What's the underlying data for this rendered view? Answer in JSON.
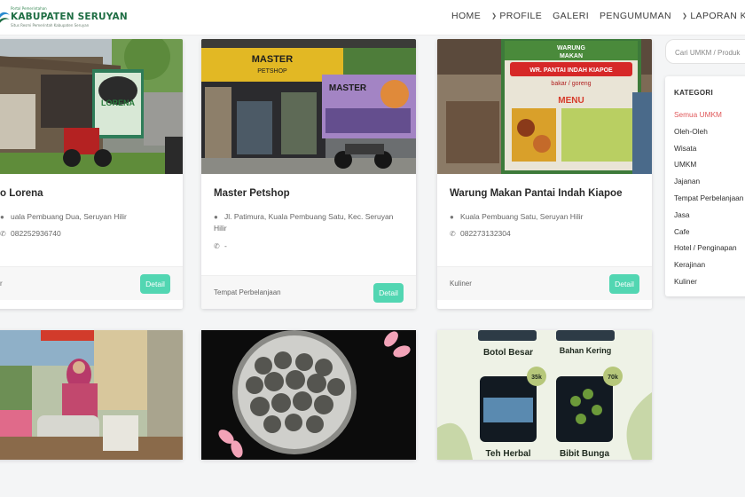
{
  "brand": {
    "small": "Portal Pemerintahan",
    "title": "KABUPATEN SERUYAN",
    "tagline": "Situs Resmi Pemerintah Kabupaten Seruyan"
  },
  "nav": {
    "home": "HOME",
    "profile": "PROFILE",
    "galeri": "GALERI",
    "pengumuman": "PENGUMUMAN",
    "laporan": "LAPORAN KEUA"
  },
  "colors": {
    "accent": "#52d6b2",
    "active_category": "#e0585a",
    "brand": "#1f6e44"
  },
  "cards": [
    {
      "title": "o Lorena",
      "address": "uala Pembuang Dua, Seruyan Hilir",
      "phone": "082252936740",
      "category": "r",
      "detail": "Detail",
      "sign": "LORENA"
    },
    {
      "title": "Master Petshop",
      "address": "Jl. Patimura, Kuala Pembuang Satu, Kec. Seruyan Hilir",
      "phone": "-",
      "category": "Tempat Perbelanjaan",
      "detail": "Detail",
      "sign": "MASTER",
      "sign2": "MASTER",
      "sign3": "PETSHOP"
    },
    {
      "title": "Warung Makan Pantai Indah Kiapoe",
      "address": "Kuala Pembuang Satu, Seruyan Hilir",
      "phone": "082273132304",
      "category": "Kuliner",
      "detail": "Detail",
      "sign_top": "WARUNG",
      "sign_mid": "MAKAN",
      "sign_name": "WR. PANTAI INDAH KIAPOE",
      "sign_sub": "bakar / goreng",
      "sign_menu": "MENU"
    }
  ],
  "bottom_cards": {
    "herbal": {
      "botol_besar": "Botol Besar",
      "bahan_kering": "Bahan Kering",
      "badge_left": "35k",
      "badge_right": "70k",
      "teh_herbal": "Teh Herbal",
      "bibit_bunga": "Bibit Bunga"
    }
  },
  "search": {
    "placeholder": "Cari UMKM / Produk"
  },
  "categories": {
    "heading": "KATEGORI",
    "items": [
      "Semua UMKM",
      "Oleh-Oleh",
      "Wisata",
      "UMKM",
      "Jajanan",
      "Tempat Perbelanjaan",
      "Jasa",
      "Cafe",
      "Hotel / Penginapan",
      "Kerajinan",
      "Kuliner"
    ],
    "active_index": 0
  },
  "icons": {
    "location": "map-pin-icon",
    "phone": "phone-icon",
    "chevron": "chevron-down-icon"
  }
}
